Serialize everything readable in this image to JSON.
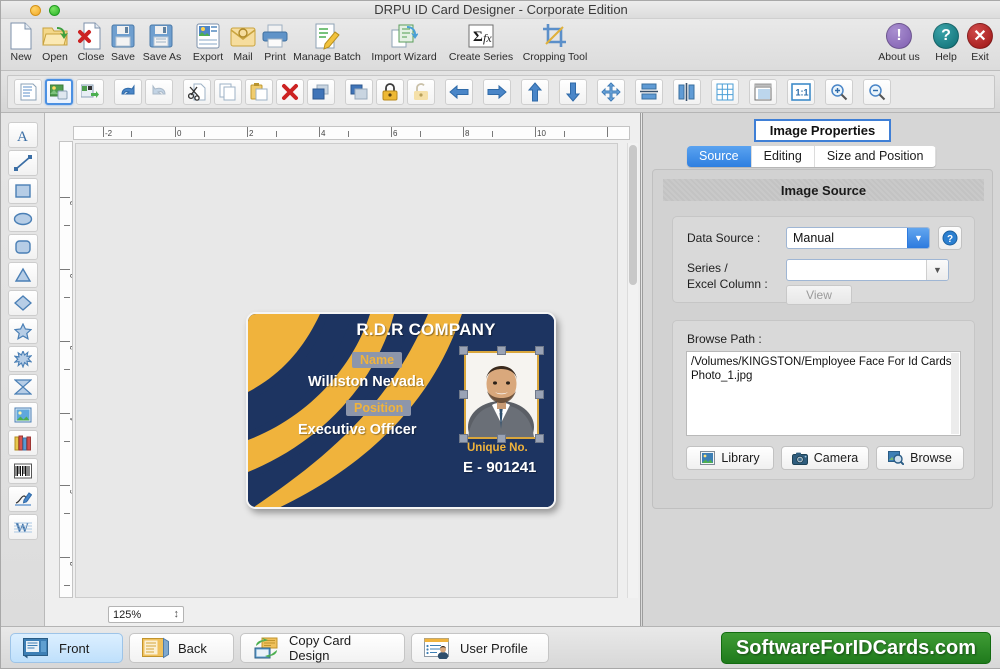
{
  "window": {
    "title": "DRPU ID Card Designer - Corporate Edition",
    "controls": [
      "minimize-yellow",
      "maximize-green"
    ]
  },
  "toolbar_main": {
    "items": [
      {
        "label": "New",
        "icon": "new-document-icon"
      },
      {
        "label": "Open",
        "icon": "open-folder-icon"
      },
      {
        "label": "Close",
        "icon": "close-document-icon"
      },
      {
        "label": "Save",
        "icon": "save-floppy-icon"
      },
      {
        "label": "Save As",
        "icon": "save-as-icon"
      },
      {
        "label": "Export",
        "icon": "export-icon"
      },
      {
        "label": "Mail",
        "icon": "mail-icon"
      },
      {
        "label": "Print",
        "icon": "printer-icon"
      },
      {
        "label": "Manage Batch",
        "icon": "manage-batch-icon"
      },
      {
        "label": "Import Wizard",
        "icon": "import-wizard-icon"
      },
      {
        "label": "Create Series",
        "icon": "create-series-sigma-icon"
      },
      {
        "label": "Cropping Tool",
        "icon": "cropping-tool-icon"
      }
    ],
    "right_items": [
      {
        "label": "About us",
        "icon": "exclamation-icon",
        "glyph": "!",
        "color": "#8d6bb5"
      },
      {
        "label": "Help",
        "icon": "question-icon",
        "glyph": "?",
        "color": "#127d83"
      },
      {
        "label": "Exit",
        "icon": "close-x-icon",
        "glyph": "✕",
        "color": "#b82020"
      }
    ]
  },
  "toolbar_secondary": {
    "buttons": [
      {
        "name": "properties-icon",
        "selected": false
      },
      {
        "name": "image-properties-icon",
        "selected": true
      },
      {
        "name": "image-export-icon",
        "selected": false
      },
      {
        "name": "undo-icon",
        "selected": false
      },
      {
        "name": "redo-icon",
        "selected": false
      },
      {
        "name": "cut-icon",
        "selected": false
      },
      {
        "name": "copy-icon",
        "selected": false
      },
      {
        "name": "paste-icon",
        "selected": false
      },
      {
        "name": "delete-icon",
        "selected": false
      },
      {
        "name": "bring-to-front-icon",
        "selected": false
      },
      {
        "name": "send-to-back-icon",
        "selected": false
      },
      {
        "name": "lock-icon",
        "selected": false
      },
      {
        "name": "unlock-icon",
        "selected": false
      },
      {
        "name": "align-left-icon",
        "selected": false
      },
      {
        "name": "align-right-icon",
        "selected": false
      },
      {
        "name": "align-top-icon",
        "selected": false
      },
      {
        "name": "align-bottom-icon",
        "selected": false
      },
      {
        "name": "align-center-icon",
        "selected": false
      },
      {
        "name": "distribute-vertical-icon",
        "selected": false
      },
      {
        "name": "distribute-horizontal-icon",
        "selected": false
      },
      {
        "name": "grid-icon",
        "selected": false
      },
      {
        "name": "page-setup-icon",
        "selected": false
      },
      {
        "name": "actual-size-icon",
        "selected": false,
        "text": "1:1"
      },
      {
        "name": "zoom-in-icon",
        "selected": false
      },
      {
        "name": "zoom-out-icon",
        "selected": false
      }
    ]
  },
  "tool_palette": {
    "tools": [
      {
        "name": "text-tool",
        "glyph": "A"
      },
      {
        "name": "line-tool"
      },
      {
        "name": "rectangle-tool"
      },
      {
        "name": "ellipse-tool"
      },
      {
        "name": "rounded-rectangle-tool"
      },
      {
        "name": "triangle-tool"
      },
      {
        "name": "diamond-tool"
      },
      {
        "name": "star-tool"
      },
      {
        "name": "burst-tool"
      },
      {
        "name": "four-point-star-tool"
      },
      {
        "name": "image-tool"
      },
      {
        "name": "library-tool"
      },
      {
        "name": "barcode-tool"
      },
      {
        "name": "signature-tool"
      },
      {
        "name": "watermark-tool",
        "glyph": "W"
      }
    ]
  },
  "canvas": {
    "zoom_value": "125%",
    "ruler_h_labels": [
      "-2",
      "0",
      "2",
      "4",
      "6",
      "8",
      "10"
    ],
    "ruler_v_labels": [
      "-2",
      "0",
      "2",
      "4",
      "6",
      "8"
    ],
    "card": {
      "company": "R.D.R COMPANY",
      "name_tag": "Name",
      "name_value": "Williston Nevada",
      "position_tag": "Position",
      "position_value": "Executive Officer",
      "unique_label": "Unique No.",
      "unique_value": "E - 901241",
      "colors": {
        "background": "#1d3461",
        "accent": "#f0b33c",
        "tag_background": "#8d96ab",
        "text": "#ffffff",
        "photo_border": "#d9a63c"
      },
      "photo_selected": true
    }
  },
  "right_panel": {
    "header": "Image Properties",
    "tabs": [
      {
        "label": "Source",
        "active": true
      },
      {
        "label": "Editing",
        "active": false
      },
      {
        "label": "Size and Position",
        "active": false
      }
    ],
    "section_title": "Image Source",
    "fields": {
      "data_source_label": "Data Source :",
      "data_source_value": "Manual",
      "series_label_line1": "Series /",
      "series_label_line2": "Excel Column :",
      "series_value": "",
      "view_button": "View",
      "help_icon": "question-help-icon"
    },
    "browse": {
      "label": "Browse Path :",
      "path": "/Volumes/KINGSTON/Employee Face For Id Cards/Photo_1.jpg",
      "buttons": [
        {
          "label": "Library",
          "icon": "library-image-icon"
        },
        {
          "label": "Camera",
          "icon": "camera-icon"
        },
        {
          "label": "Browse",
          "icon": "browse-search-icon"
        }
      ]
    }
  },
  "bottom_bar": {
    "buttons": [
      {
        "label": "Front",
        "icon": "card-front-icon",
        "active": true
      },
      {
        "label": "Back",
        "icon": "card-back-icon",
        "active": false
      },
      {
        "label": "Copy Card Design",
        "icon": "copy-card-design-icon",
        "active": false
      },
      {
        "label": "User Profile",
        "icon": "user-profile-icon",
        "active": false
      }
    ],
    "brand": "SoftwareForIDCards.com",
    "brand_color": "#2d8a29"
  }
}
